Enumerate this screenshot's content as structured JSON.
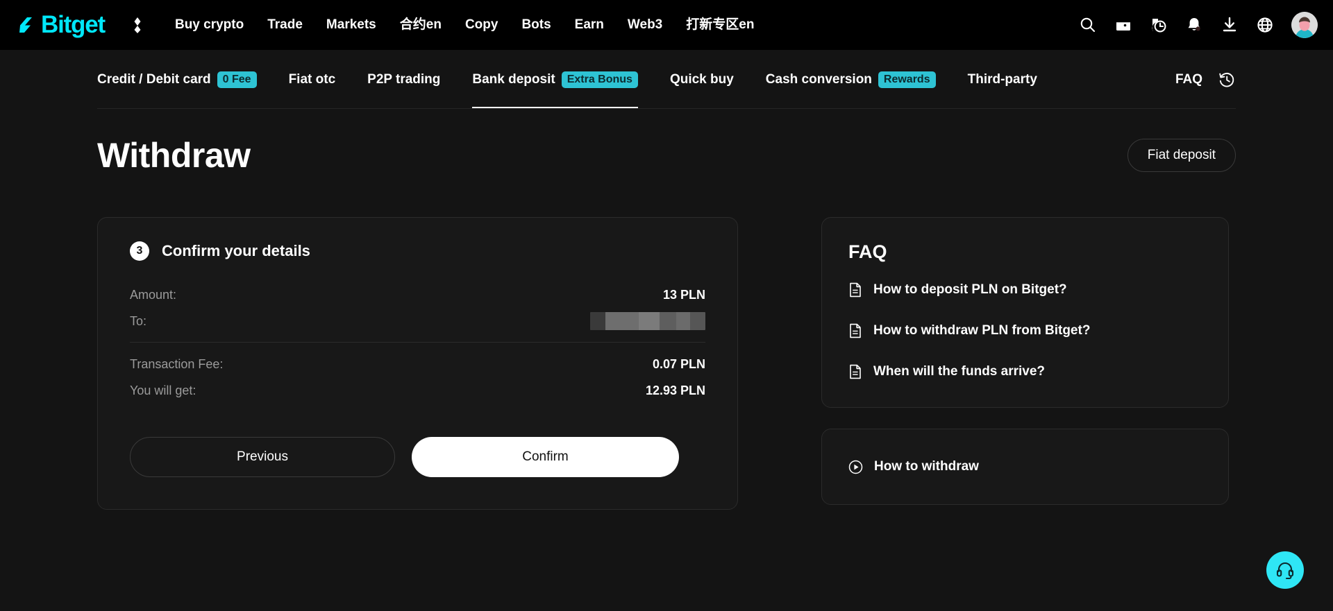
{
  "header": {
    "brand": "Bitget",
    "brand_color": "#00e7f9",
    "nav": [
      {
        "label": "Buy crypto"
      },
      {
        "label": "Trade"
      },
      {
        "label": "Markets"
      },
      {
        "label": "合约en"
      },
      {
        "label": "Copy"
      },
      {
        "label": "Bots"
      },
      {
        "label": "Earn"
      },
      {
        "label": "Web3"
      },
      {
        "label": "打新专区en"
      }
    ],
    "icons": [
      {
        "name": "search-icon"
      },
      {
        "name": "wallet-icon"
      },
      {
        "name": "order-history-icon"
      },
      {
        "name": "notification-bell-icon"
      },
      {
        "name": "download-icon"
      },
      {
        "name": "language-globe-icon"
      },
      {
        "name": "avatar"
      }
    ]
  },
  "subnav": {
    "tabs": [
      {
        "label": "Credit / Debit card",
        "badge": "0 Fee",
        "active": false
      },
      {
        "label": "Fiat otc",
        "badge": "",
        "active": false
      },
      {
        "label": "P2P trading",
        "badge": "",
        "active": false
      },
      {
        "label": "Bank deposit",
        "badge": "Extra Bonus",
        "active": true
      },
      {
        "label": "Quick buy",
        "badge": "",
        "active": false
      },
      {
        "label": "Cash conversion",
        "badge": "Rewards",
        "active": false
      },
      {
        "label": "Third-party",
        "badge": "",
        "active": false
      }
    ],
    "faq_label": "FAQ",
    "history_icon": "history-icon",
    "badge_color": "#2ec3d4"
  },
  "page": {
    "title": "Withdraw",
    "fiat_deposit_button": "Fiat deposit"
  },
  "confirm_card": {
    "step_number": "3",
    "step_title": "Confirm your details",
    "rows": [
      {
        "label": "Amount:",
        "value": "13 PLN",
        "redacted": false
      },
      {
        "label": "To:",
        "value": "",
        "redacted": true
      },
      {
        "label": "Transaction Fee:",
        "value": "0.07 PLN",
        "redacted": false
      },
      {
        "label": "You will get:",
        "value": "12.93 PLN",
        "redacted": false
      }
    ],
    "previous_button": "Previous",
    "confirm_button": "Confirm"
  },
  "faq_panel": {
    "title": "FAQ",
    "items": [
      {
        "label": "How to deposit PLN on Bitget?",
        "icon": "document-icon"
      },
      {
        "label": "How to withdraw PLN from Bitget?",
        "icon": "document-icon"
      },
      {
        "label": "When will the funds arrive?",
        "icon": "document-icon"
      }
    ]
  },
  "video_card": {
    "label": "How to withdraw",
    "icon": "play-circle-icon"
  },
  "support": {
    "icon": "headset-support-icon",
    "color": "#2fe6f5"
  }
}
